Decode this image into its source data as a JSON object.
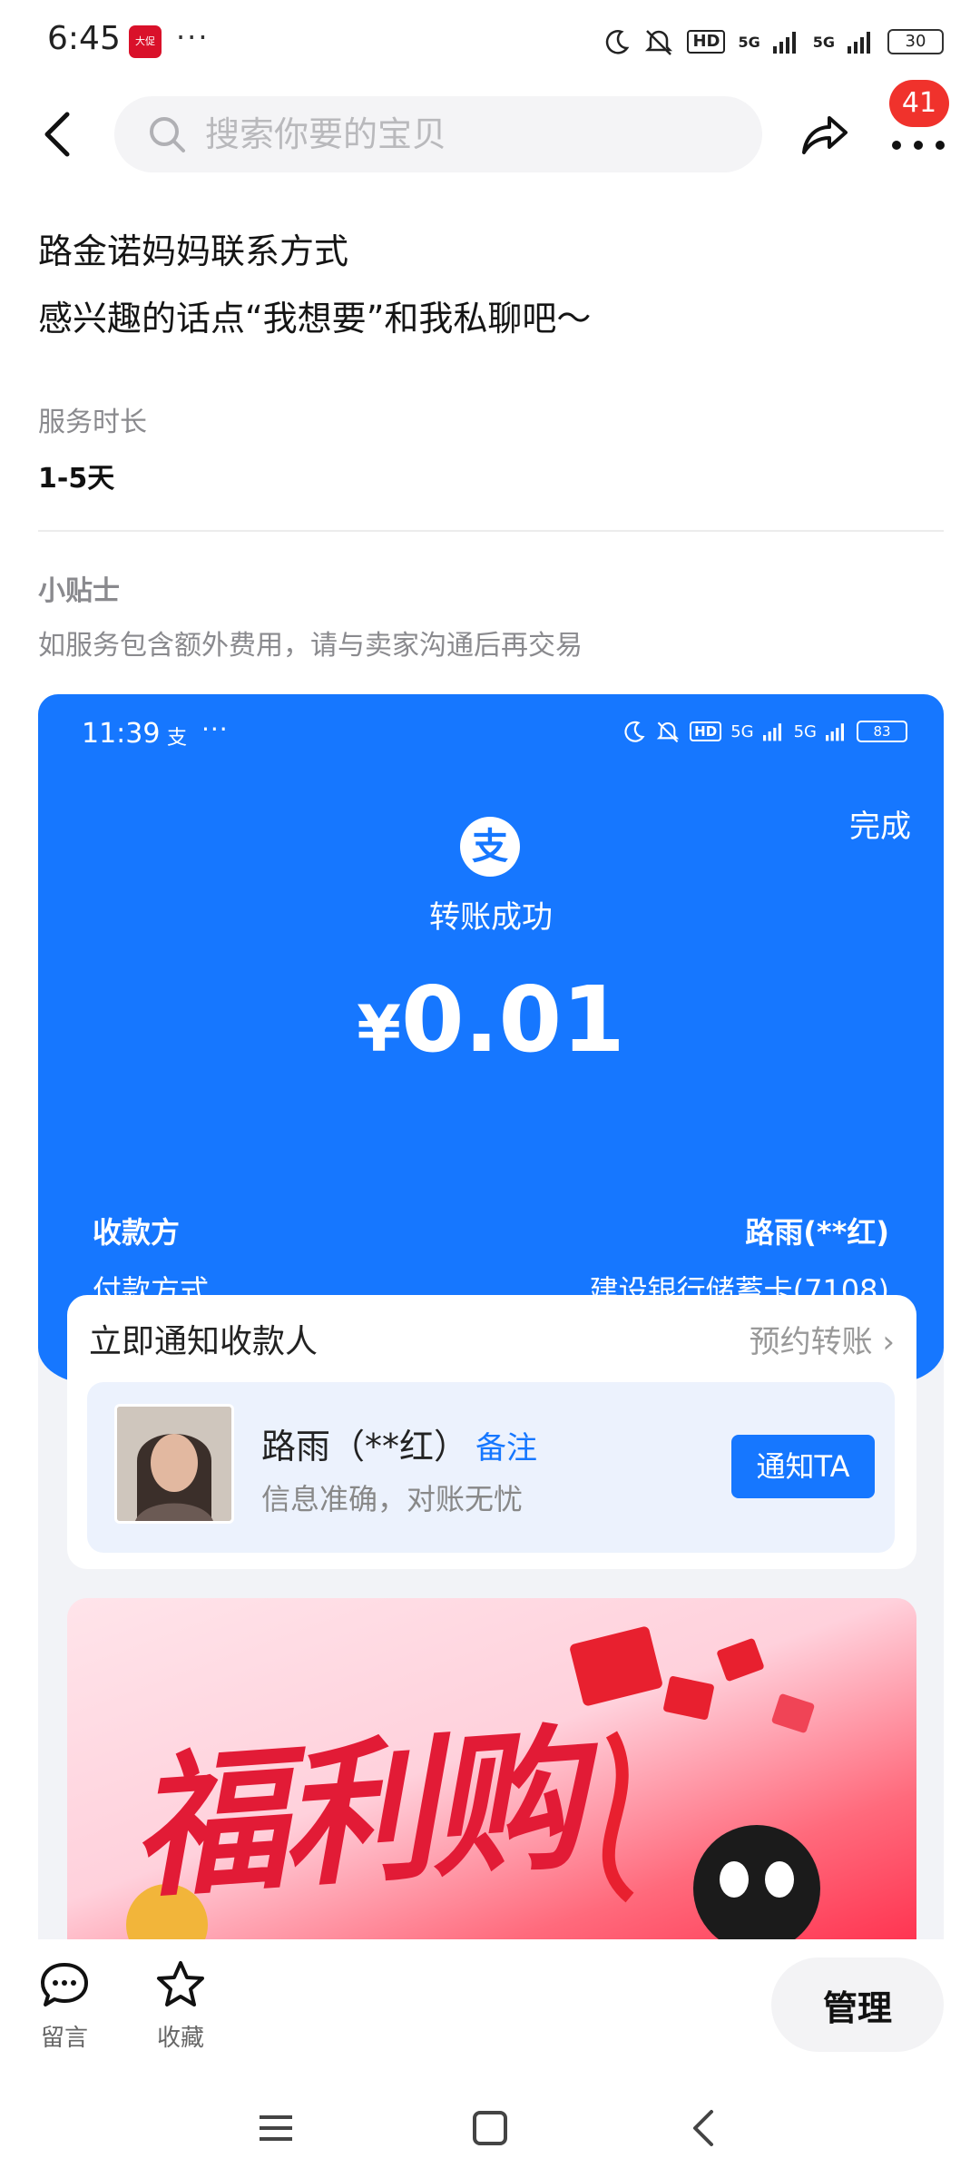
{
  "status_bar": {
    "time": "6:45",
    "app_icon_text": "大促",
    "more_dots": "···",
    "hd_label": "HD",
    "signal_1": "5G",
    "signal_2": "5G",
    "battery": "30"
  },
  "header": {
    "search_placeholder": "搜索你要的宝贝",
    "badge_count": "41"
  },
  "content": {
    "description_line1": "路金诺妈妈联系方式",
    "description_line2": "感兴趣的话点“我想要”和我私聊吧～",
    "service_duration_label": "服务时长",
    "service_duration_value": "1-5天",
    "tips_title": "小贴士",
    "tips_text": "如服务包含额外费用，请与卖家沟通后再交易"
  },
  "embedded_screenshot": {
    "time": "11:39",
    "app_glyph": "支",
    "dots": "···",
    "hd_label": "HD",
    "signal_1": "5G",
    "signal_2": "5G",
    "battery": "83",
    "done_label": "完成",
    "logo_glyph": "支",
    "success_text": "转账成功",
    "currency": "¥",
    "amount": "0.01",
    "payee_label": "收款方",
    "payee_value": "路雨(**红)",
    "payment_method_label": "付款方式",
    "payment_method_value": "建设银行储蓄卡(7108)",
    "notify_title": "立即通知收款人",
    "schedule_link": "预约转账 ›",
    "payee_name": "路雨（**红）",
    "note_label": "备注",
    "payee_subtext": "信息准确，对账无忧",
    "notify_button": "通知TA",
    "promo_text": "福利购"
  },
  "bottom_bar": {
    "comment_label": "留言",
    "favorite_label": "收藏",
    "manage_label": "管理"
  },
  "colors": {
    "alipay_blue": "#1677ff",
    "badge_red": "#f0322c",
    "promo_red": "#e21b36"
  }
}
